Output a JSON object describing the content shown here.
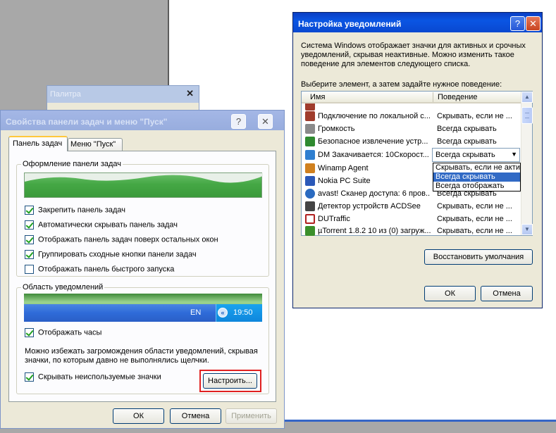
{
  "palette": {
    "title": "Палитра"
  },
  "taskbar_dialog": {
    "title": "Свойства панели задач и меню \"Пуск\"",
    "help_btn": "?",
    "close_btn": "✕",
    "tabs": [
      "Панель задач",
      "Меню \"Пуск\""
    ],
    "appearance_group": {
      "title": "Оформление панели задач",
      "checkboxes": [
        {
          "label": "Закрепить панель задач",
          "checked": true
        },
        {
          "label": "Автоматически скрывать панель задач",
          "checked": true
        },
        {
          "label": "Отображать панель задач поверх остальных окон",
          "checked": true
        },
        {
          "label": "Группировать сходные кнопки панели задач",
          "checked": true
        },
        {
          "label": "Отображать панель быстрого запуска",
          "checked": false
        }
      ]
    },
    "notify_group": {
      "title": "Область уведомлений",
      "tray_lang": "EN",
      "tray_time": "19:50",
      "show_clock": {
        "label": "Отображать часы",
        "checked": true
      },
      "description": [
        "Можно избежать загромождения области уведомлений, скрывая",
        "значки, по которым давно не выполнялись щелчки."
      ],
      "hide_inactive": {
        "label": "Скрывать неиспользуемые значки",
        "checked": true
      },
      "customize_btn": "Настроить..."
    },
    "buttons": {
      "ok": "ОК",
      "cancel": "Отмена",
      "apply": "Применить"
    }
  },
  "notify_dialog": {
    "title": "Настройка уведомлений",
    "help_btn": "?",
    "close_btn": "✕",
    "intro": [
      "Система Windows отображает значки для активных и срочных",
      "уведомлений, скрывая неактивные. Можно изменить такое",
      "поведение для элементов следующего списка."
    ],
    "prompt": "Выберите элемент, а затем задайте нужное поведение:",
    "columns": {
      "name": "Имя",
      "behavior": "Поведение"
    },
    "rows": [
      {
        "name": "Подключение по локальной с...",
        "behavior": "Скрывать, если не ...",
        "icon_color": "#a03c2c"
      },
      {
        "name": "Громкость",
        "behavior": "Всегда скрывать",
        "icon_color": "#8a8a8a"
      },
      {
        "name": "Безопасное извлечение устр...",
        "behavior": "Всегда скрывать",
        "icon_color": "#2f8a2f"
      },
      {
        "name": "DM Закачивается: 10Скорост...",
        "behavior": "Всегда скрывать",
        "icon_color": "#2f7fd0"
      },
      {
        "name": "Winamp Agent",
        "behavior": "",
        "icon_color": "#d0801f"
      },
      {
        "name": "Nokia PC Suite",
        "behavior": "",
        "icon_color": "#2a58b8"
      },
      {
        "name": "avast! Сканер доступа: 6 пров...",
        "behavior": "Всегда скрывать",
        "icon_color": "#2a6ac0"
      },
      {
        "name": "Детектор устройств ACDSee",
        "behavior": "Скрывать, если не ...",
        "icon_color": "#444444"
      },
      {
        "name": "DUTraffic",
        "behavior": "Скрывать, если не ...",
        "icon_color": "#b02020"
      },
      {
        "name": "µTorrent 1.8.2 10 из (0) загруж...",
        "behavior": "Скрывать, если не ...",
        "icon_color": "#3b8f2b"
      }
    ],
    "dropdown_options": [
      "Скрывать, если не акти",
      "Всегда скрывать",
      "Всегда отображать"
    ],
    "dropdown_selected_index": 1,
    "restore_btn": "Восстановить умолчания",
    "ok": "ОК",
    "cancel": "Отмена"
  }
}
